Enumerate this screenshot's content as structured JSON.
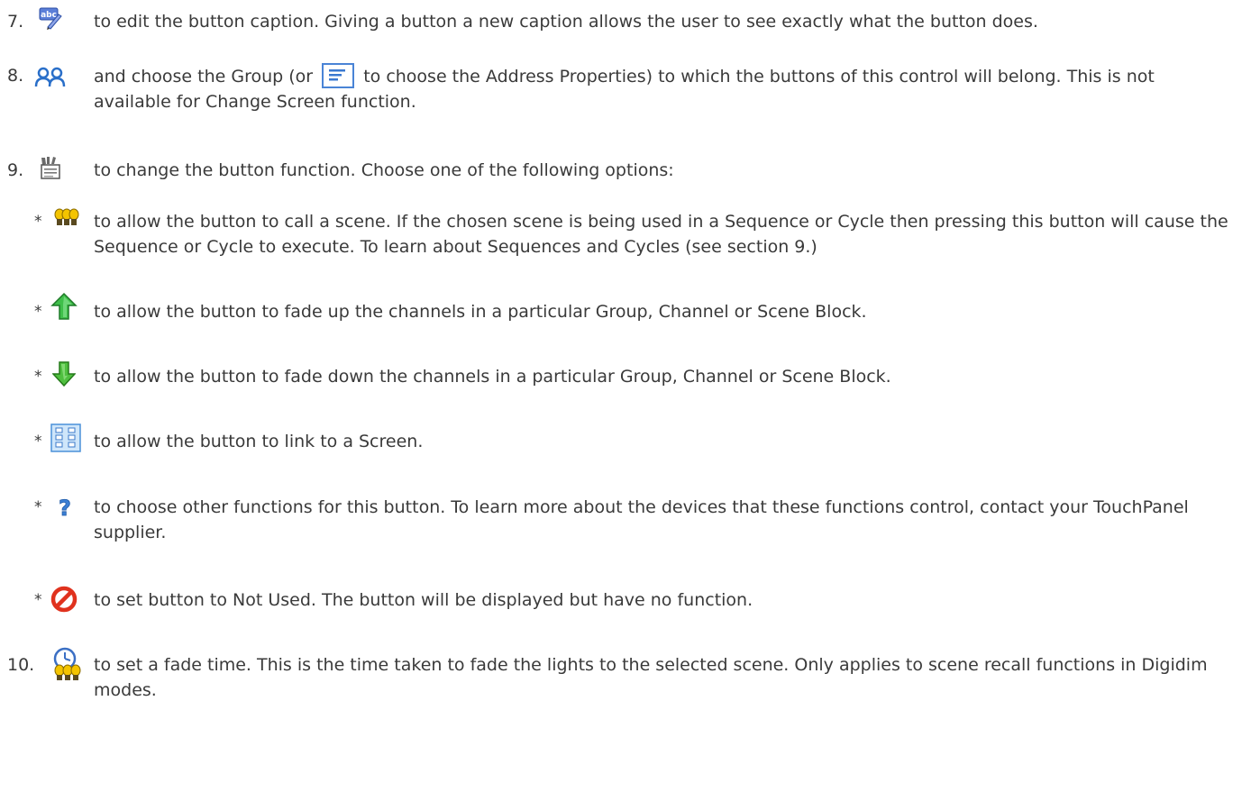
{
  "steps": [
    {
      "num": "7.",
      "icon": "edit-caption-icon",
      "text": "to edit the button caption. Giving a button a new caption allows the user to see exactly what the button does."
    },
    {
      "num": "8.",
      "icon": "group-icon",
      "text_before": "and choose the Group (or",
      "inline_icon": "address-properties-icon",
      "text_after": "to choose the Address Properties) to which the buttons of this control will belong. This is not available for Change Screen function."
    },
    {
      "num": "9.",
      "icon": "clapperboard-icon",
      "text": "to change the button function. Choose one of the following options:"
    }
  ],
  "options": [
    {
      "bullet": "*",
      "icon": "scene-icon",
      "text": "to allow the button to call a scene. If the chosen scene is being used in a Sequence or Cycle then pressing this button will cause the Sequence or Cycle to execute. To learn about Sequences and Cycles (see section 9.)"
    },
    {
      "bullet": "*",
      "icon": "fade-up-arrow-icon",
      "text": "to allow the button to fade up the channels in a particular Group, Channel or Scene Block."
    },
    {
      "bullet": "*",
      "icon": "fade-down-arrow-icon",
      "text": "to allow the button to fade down the channels in a particular Group, Channel or Scene Block."
    },
    {
      "bullet": "*",
      "icon": "screen-link-icon",
      "text": "to allow the button to link to a Screen."
    },
    {
      "bullet": "*",
      "icon": "question-icon",
      "text": "to choose other functions for this button. To learn more about the devices that these functions control, contact your TouchPanel supplier."
    },
    {
      "bullet": "*",
      "icon": "not-used-icon",
      "text": "to set button to Not Used. The button will be displayed but have no function."
    }
  ],
  "final_step": {
    "num": "10.",
    "icon": "fade-time-icon",
    "text": "to set a fade time. This is the time taken to fade the lights to the selected scene. Only applies to scene recall functions in Digidim modes."
  }
}
